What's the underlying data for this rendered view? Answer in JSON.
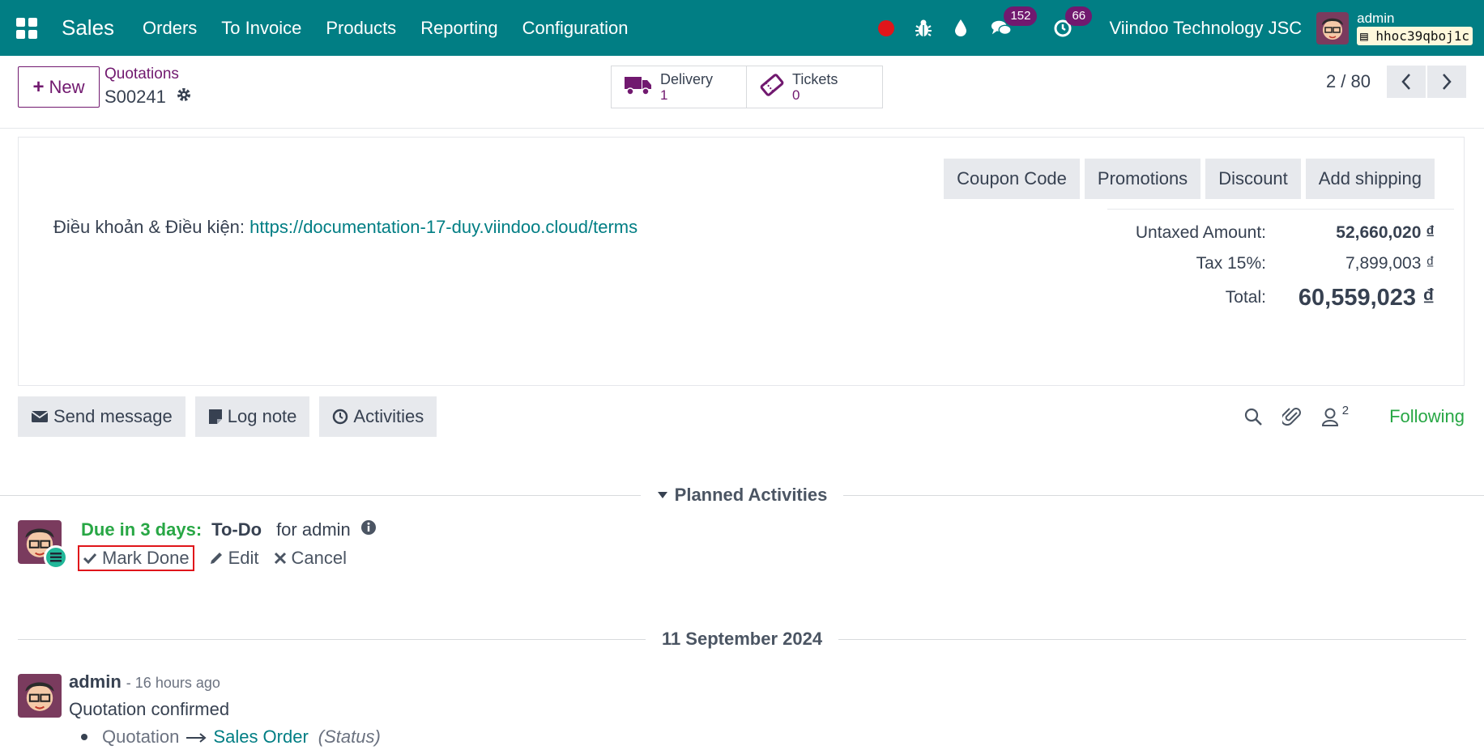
{
  "navbar": {
    "app_name": "Sales",
    "menu": [
      "Orders",
      "To Invoice",
      "Products",
      "Reporting",
      "Configuration"
    ],
    "messages_badge": "152",
    "activities_badge": "66",
    "company": "Viindoo Technology JSC",
    "user": "admin",
    "database": "hhoc39qboj1c",
    "colors": {
      "bar": "#017e84",
      "badge": "#71196f",
      "record": "#e0151a"
    }
  },
  "control": {
    "new_label": "New",
    "breadcrumb_parent": "Quotations",
    "breadcrumb_current": "S00241",
    "smart_buttons": [
      {
        "label": "Delivery",
        "value": "1",
        "icon": "truck-icon"
      },
      {
        "label": "Tickets",
        "value": "0",
        "icon": "ticket-icon"
      }
    ],
    "pager": "2 / 80"
  },
  "sheet": {
    "buttons": [
      "Coupon Code",
      "Promotions",
      "Discount",
      "Add shipping"
    ],
    "terms_label": "Điều khoản & Điều kiện:",
    "terms_link": "https://documentation-17-duy.viindoo.cloud/terms",
    "totals": {
      "untaxed_label": "Untaxed Amount:",
      "untaxed_value": "52,660,020 ₫",
      "tax_label": "Tax 15%:",
      "tax_value": "7,899,003 ₫",
      "total_label": "Total:",
      "total_value": "60,559,023 ₫"
    }
  },
  "chatter": {
    "send_message": "Send message",
    "log_note": "Log note",
    "activities": "Activities",
    "followers_count": "2",
    "following": "Following",
    "planned_title": "Planned Activities",
    "activity": {
      "due": "Due in 3 days:",
      "type": "To-Do",
      "assignee": "for admin",
      "mark_done": "Mark Done",
      "edit": "Edit",
      "cancel": "Cancel"
    },
    "date_separator": "11 September 2024",
    "message": {
      "author": "admin",
      "date": "- 16 hours ago",
      "body": "Quotation confirmed",
      "old_value": "Quotation",
      "new_value": "Sales Order",
      "field": "(Status)"
    }
  }
}
